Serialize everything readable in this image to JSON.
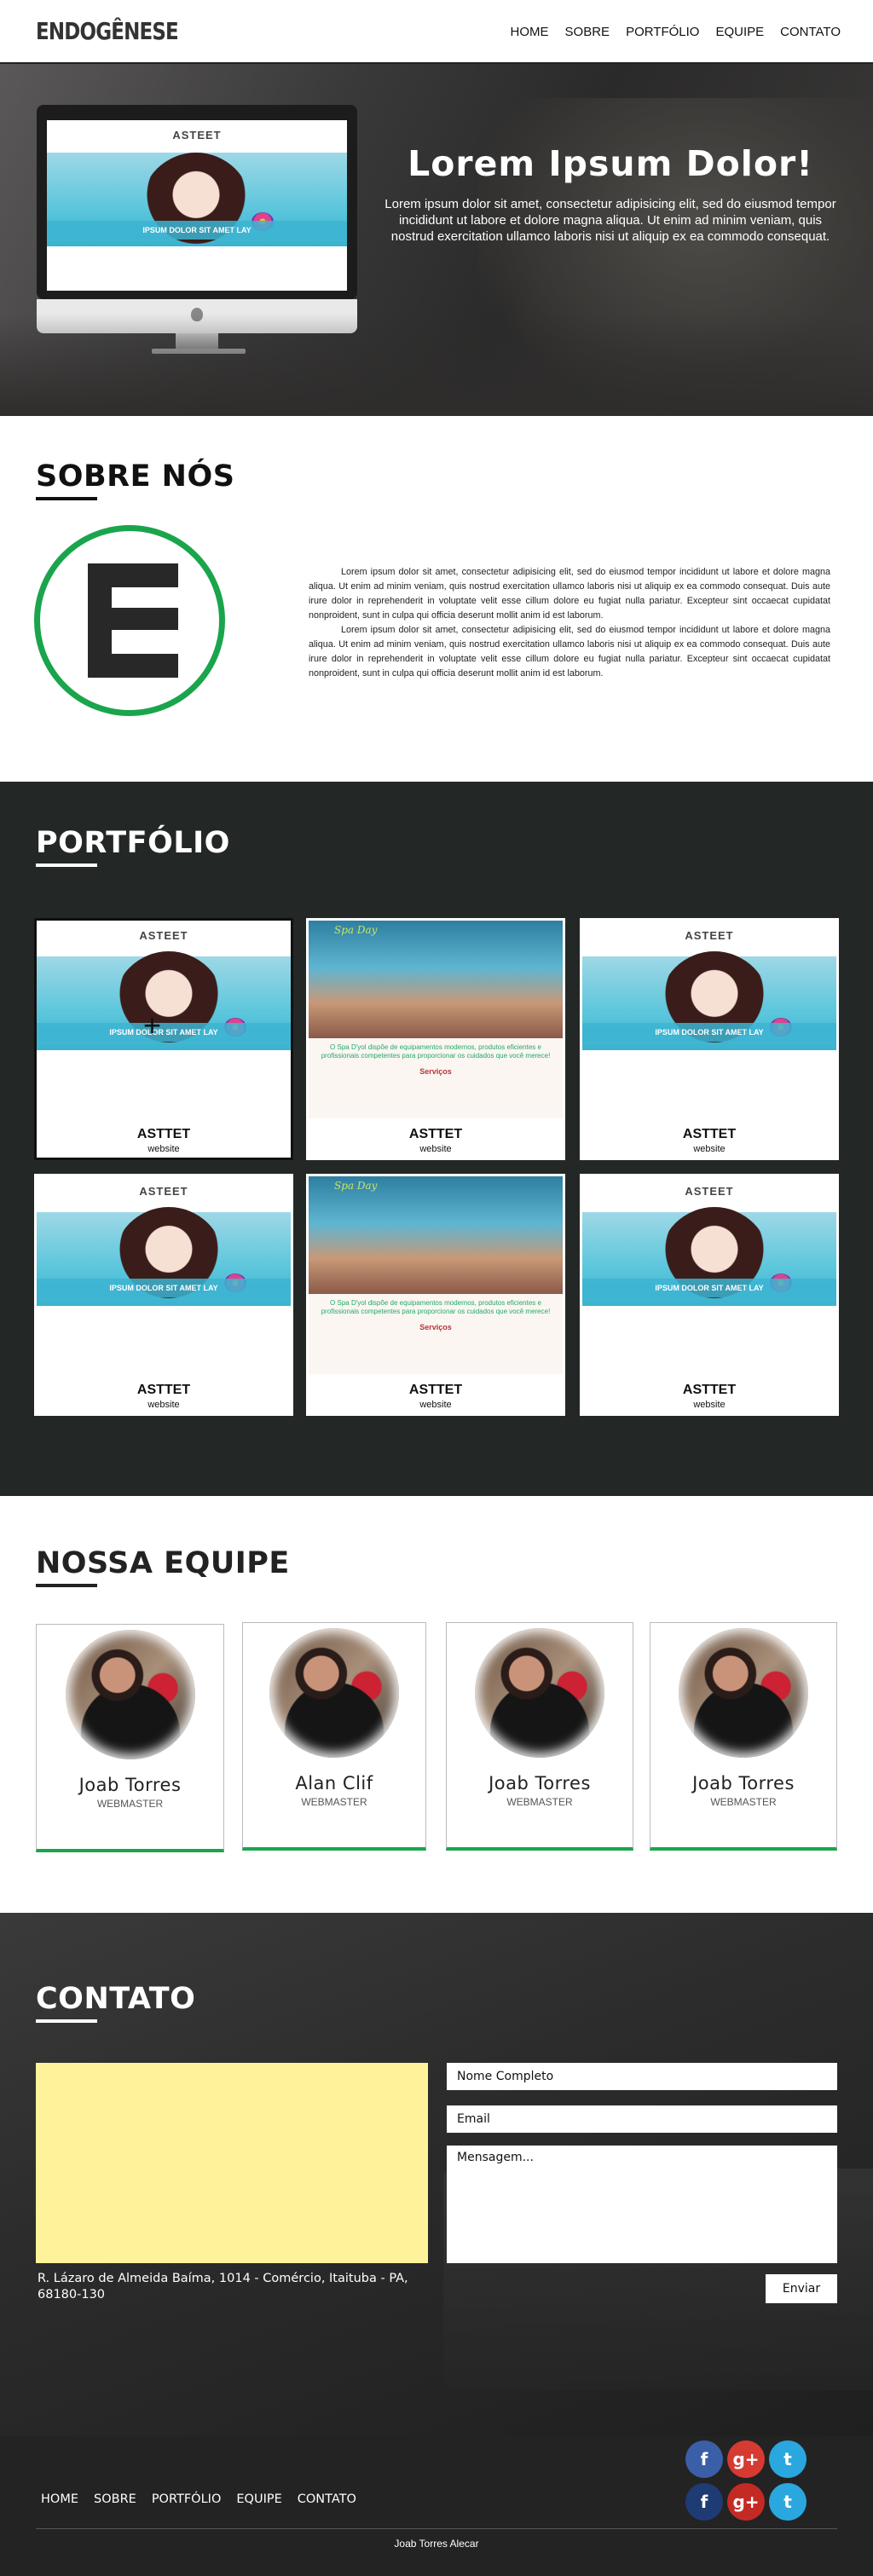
{
  "header": {
    "logo": "ENDOGÊNESE",
    "nav": [
      "HOME",
      "SOBRE",
      "PORTFÓLIO",
      "EQUIPE",
      "CONTATO"
    ]
  },
  "hero": {
    "title": "Lorem Ipsum Dolor!",
    "body": "Lorem ipsum dolor sit amet, consectetur adipisicing elit, sed do eiusmod tempor incididunt ut labore et dolore magna aliqua. Ut enim ad minim veniam, quis nostrud exercitation ullamco laboris nisi ut aliquip ex ea commodo consequat.",
    "mock_title": "ASTEET",
    "mock_band": "IPSUM DOLOR SIT AMET LAY"
  },
  "sobre": {
    "title": "SOBRE NÓS",
    "paragraph1": "Lorem ipsum dolor sit amet, consectetur adipisicing elit, sed do eiusmod tempor incididunt ut labore et dolore magna aliqua. Ut enim ad minim veniam, quis nostrud exercitation ullamco laboris nisi ut aliquip ex ea commodo consequat. Duis aute irure dolor in reprehenderit in voluptate velit esse cillum dolore eu fugiat nulla pariatur. Excepteur sint occaecat cupidatat nonproident, sunt in culpa qui officia deserunt mollit anim id est laborum.",
    "paragraph2": "Lorem ipsum dolor sit amet, consectetur adipisicing elit, sed do eiusmod tempor incididunt ut labore et dolore magna aliqua. Ut enim ad minim veniam, quis nostrud exercitation ullamco laboris nisi ut aliquip ex ea commodo consequat. Duis aute irure dolor in reprehenderit in voluptate velit esse cillum dolore eu fugiat nulla pariatur. Excepteur sint occaecat cupidatat nonproident, sunt in culpa qui officia deserunt mollit anim id est laborum."
  },
  "portfolio": {
    "title": "PORTFÓLIO",
    "items": [
      {
        "name": "ASTTET",
        "type": "website",
        "mock": "asteet",
        "mock_title": "ASTEET",
        "band": "IPSUM DOLOR SIT AMET LAY"
      },
      {
        "name": "ASTTET",
        "type": "website",
        "mock": "spa",
        "spa_logo": "Spa Day",
        "headline": "O Spa D'yol dispõe de equipamentos modernos, produtos eficientes e profissionais competentes para proporcionar os cuidados que você merece!",
        "sub": "Serviços"
      },
      {
        "name": "ASTTET",
        "type": "website",
        "mock": "asteet",
        "mock_title": "ASTEET",
        "band": "IPSUM DOLOR SIT AMET LAY"
      },
      {
        "name": "ASTTET",
        "type": "website",
        "mock": "asteet",
        "mock_title": "ASTEET",
        "band": "IPSUM DOLOR SIT AMET LAY"
      },
      {
        "name": "ASTTET",
        "type": "website",
        "mock": "spa",
        "spa_logo": "Spa Day",
        "headline": "O Spa D'yol dispõe de equipamentos modernos, produtos eficientes e profissionais competentes para proporcionar os cuidados que você merece!",
        "sub": "Serviços"
      },
      {
        "name": "ASTTET",
        "type": "website",
        "mock": "asteet",
        "mock_title": "ASTEET",
        "band": "IPSUM DOLOR SIT AMET LAY"
      }
    ]
  },
  "equipe": {
    "title": "NOSSA EQUIPE",
    "members": [
      {
        "name": "Joab Torres",
        "role": "WEBMASTER"
      },
      {
        "name": "Alan Clif",
        "role": "WEBMASTER"
      },
      {
        "name": "Joab Torres",
        "role": "WEBMASTER"
      },
      {
        "name": "Joab Torres",
        "role": "WEBMASTER"
      }
    ]
  },
  "contato": {
    "title": "CONTATO",
    "address": "R. Lázaro de Almeida Baíma, 1014 - Comércio, Itaituba - PA, 68180-130",
    "name_placeholder": "Nome Completo",
    "email_placeholder": "Email",
    "message_placeholder": "Mensagem...",
    "send_label": "Enviar",
    "map_color": "#fef29b"
  },
  "footer": {
    "nav": [
      "HOME",
      "SOBRE",
      "PORTFÓLIO",
      "EQUIPE",
      "CONTATO"
    ],
    "credit": "Joab Torres Alecar",
    "social_glyphs": {
      "facebook": "f",
      "googleplus": "g+",
      "twitter": "t"
    }
  },
  "colors": {
    "accent": "#1aa54c",
    "dark_section": "#232826",
    "footer": "#232323"
  }
}
